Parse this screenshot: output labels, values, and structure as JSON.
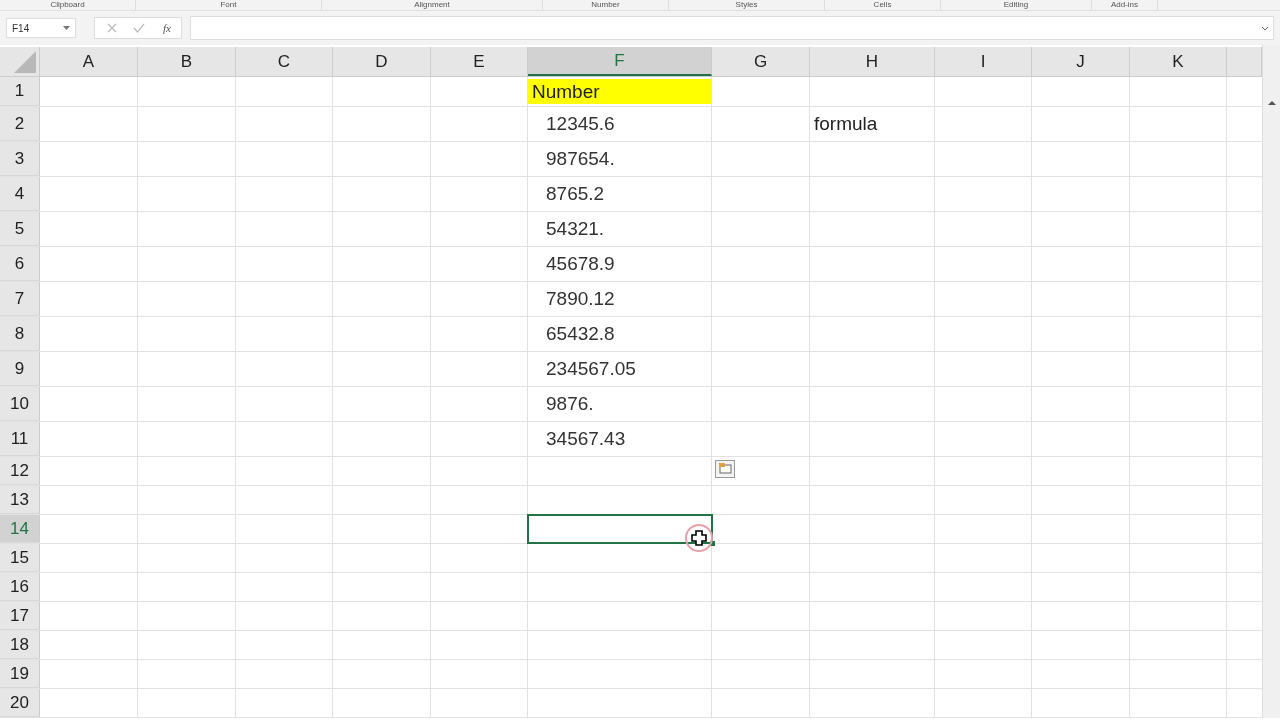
{
  "ribbon_groups": [
    "Clipboard",
    "Font",
    "Alignment",
    "Number",
    "Styles",
    "Cells",
    "Editing",
    "Add-ins"
  ],
  "name_box": "F14",
  "formula_bar": {
    "function_label": "fx"
  },
  "columns": [
    {
      "label": "A",
      "selected": false
    },
    {
      "label": "B",
      "selected": false
    },
    {
      "label": "C",
      "selected": false
    },
    {
      "label": "D",
      "selected": false
    },
    {
      "label": "E",
      "selected": false
    },
    {
      "label": "F",
      "selected": true
    },
    {
      "label": "G",
      "selected": false
    },
    {
      "label": "H",
      "selected": false
    },
    {
      "label": "I",
      "selected": false
    },
    {
      "label": "J",
      "selected": false
    },
    {
      "label": "K",
      "selected": false
    }
  ],
  "rows": [
    {
      "label": "1",
      "selected": false,
      "cells": {
        "c5": {
          "text": "Number",
          "highlight": true,
          "indent": false
        }
      }
    },
    {
      "label": "2",
      "selected": false,
      "cells": {
        "c5": {
          "text": "12345.6",
          "highlight": false,
          "indent": true
        },
        "c7": {
          "text": "formula",
          "highlight": false,
          "indent": false
        }
      }
    },
    {
      "label": "3",
      "selected": false,
      "cells": {
        "c5": {
          "text": "987654.",
          "highlight": false,
          "indent": true
        }
      }
    },
    {
      "label": "4",
      "selected": false,
      "cells": {
        "c5": {
          "text": "8765.2",
          "highlight": false,
          "indent": true
        }
      }
    },
    {
      "label": "5",
      "selected": false,
      "cells": {
        "c5": {
          "text": "54321.",
          "highlight": false,
          "indent": true
        }
      }
    },
    {
      "label": "6",
      "selected": false,
      "cells": {
        "c5": {
          "text": "45678.9",
          "highlight": false,
          "indent": true
        }
      }
    },
    {
      "label": "7",
      "selected": false,
      "cells": {
        "c5": {
          "text": "7890.12",
          "highlight": false,
          "indent": true
        }
      }
    },
    {
      "label": "8",
      "selected": false,
      "cells": {
        "c5": {
          "text": "65432.8",
          "highlight": false,
          "indent": true
        }
      }
    },
    {
      "label": "9",
      "selected": false,
      "cells": {
        "c5": {
          "text": "234567.05",
          "highlight": false,
          "indent": true
        }
      }
    },
    {
      "label": "10",
      "selected": false,
      "cells": {
        "c5": {
          "text": "9876.",
          "highlight": false,
          "indent": true
        }
      }
    },
    {
      "label": "11",
      "selected": false,
      "cells": {
        "c5": {
          "text": "34567.43",
          "highlight": false,
          "indent": true
        }
      }
    },
    {
      "label": "12",
      "selected": false
    },
    {
      "label": "13",
      "selected": false
    },
    {
      "label": "14",
      "selected": true
    },
    {
      "label": "15",
      "selected": false
    },
    {
      "label": "16",
      "selected": false
    },
    {
      "label": "17",
      "selected": false
    },
    {
      "label": "18",
      "selected": false
    },
    {
      "label": "19",
      "selected": false
    },
    {
      "label": "20",
      "selected": false
    }
  ]
}
